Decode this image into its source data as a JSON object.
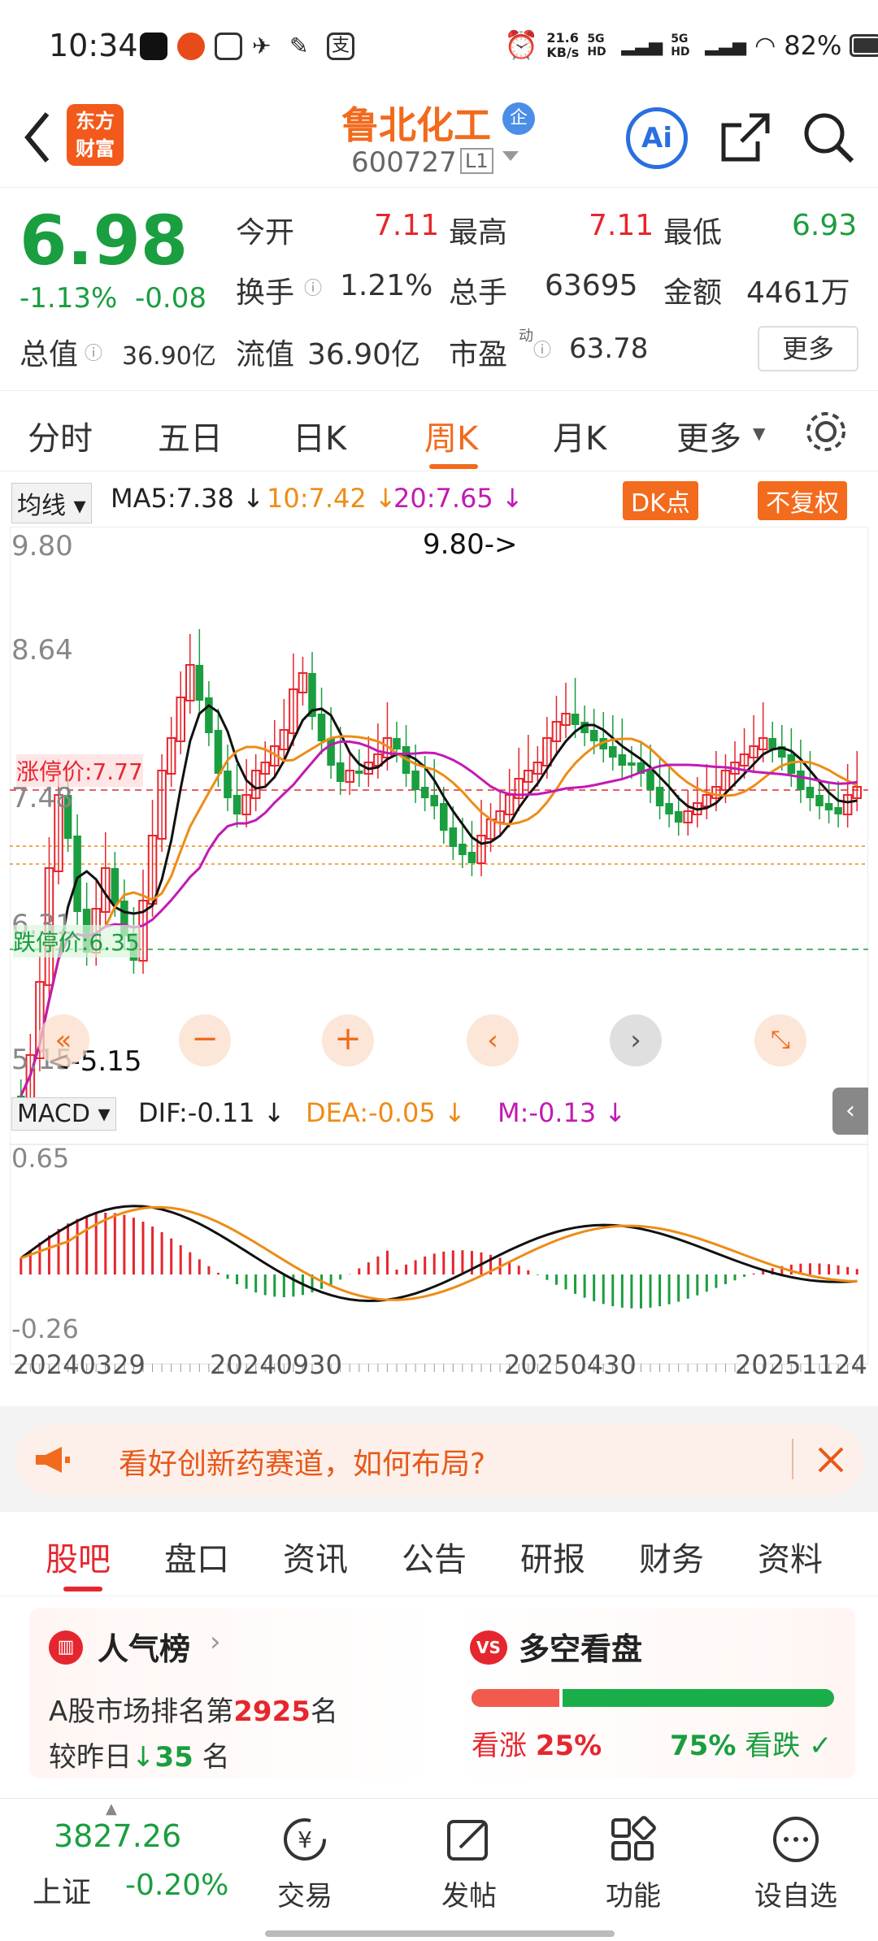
{
  "status": {
    "time": "10:34",
    "net_speed": "21.6",
    "net_unit": "KB/s",
    "sig1": "5G HD",
    "sig2": "5G HD",
    "battery": "82%"
  },
  "header": {
    "logo_line1": "东方",
    "logo_line2": "财富",
    "stock_name": "鲁北化工",
    "stock_badge": "企",
    "stock_code": "600727",
    "level": "L1",
    "ai": "Ai"
  },
  "quote": {
    "price": "6.98",
    "change_pct": "-1.13%",
    "change": "-0.08",
    "open_label": "今开",
    "open": "7.11",
    "high_label": "最高",
    "high": "7.11",
    "low_label": "最低",
    "low": "6.93",
    "turnover_label": "换手",
    "turnover": "1.21%",
    "volume_label": "总手",
    "volume": "63695",
    "amount_label": "金额",
    "amount": "4461万",
    "mktcap_label": "总值",
    "mktcap": "36.90亿",
    "float_label": "流值",
    "float": "36.90亿",
    "pe_label": "市盈",
    "pe_sup": "动",
    "pe": "63.78",
    "more": "更多"
  },
  "tabs": [
    "分时",
    "五日",
    "日K",
    "周K",
    "月K",
    "更多"
  ],
  "chart": {
    "ma_select": "均线",
    "ma5": "MA5:7.38 ↓",
    "ma10": "10:7.42 ↓",
    "ma20": "20:7.65 ↓",
    "dk_btn": "DK点",
    "fq_btn": "不复权",
    "y_top": "9.80",
    "y_mid1": "8.64",
    "y_mid2": "7.48",
    "y_mid3": "6.31",
    "y_bot": "5.15",
    "max_label": "9.80->",
    "min_label": "<-5.15",
    "limit_up": "涨停价:7.77",
    "limit_down": "跌停价:6.35",
    "macd_select": "MACD",
    "dif": "DIF:-0.11 ↓",
    "dea": "DEA:-0.05 ↓",
    "m": "M:-0.13 ↓",
    "macd_top": "0.65",
    "macd_bot": "-0.26",
    "dates": [
      "20240329",
      "20240930",
      "20250430",
      "20251124"
    ],
    "colors": {
      "up": "#e6262e",
      "down": "#1a9e3f",
      "ma5": "#111111",
      "ma10": "#ee8c16",
      "ma20": "#c21ab3"
    }
  },
  "banner": {
    "text": "看好创新药赛道，如何布局?"
  },
  "subtabs": [
    "股吧",
    "盘口",
    "资讯",
    "公告",
    "研报",
    "财务",
    "资料"
  ],
  "cards": {
    "pop_title": "人气榜",
    "pop_line1_pre": "A股市场排名第",
    "pop_rank": "2925",
    "pop_line1_post": "名",
    "pop_line2_pre": "较昨日",
    "pop_change": "35",
    "pop_line2_post": "名",
    "vs_title": "多空看盘",
    "bull_label": "看涨",
    "bull_pct": "25%",
    "bear_pct": "75%",
    "bear_label": "看跌",
    "bull_ratio": 0.25
  },
  "bottom": {
    "index_value": "3827.26",
    "index_name": "上证",
    "index_change": "-0.20%",
    "trade": "交易",
    "post": "发帖",
    "func": "功能",
    "watch": "设自选"
  }
}
